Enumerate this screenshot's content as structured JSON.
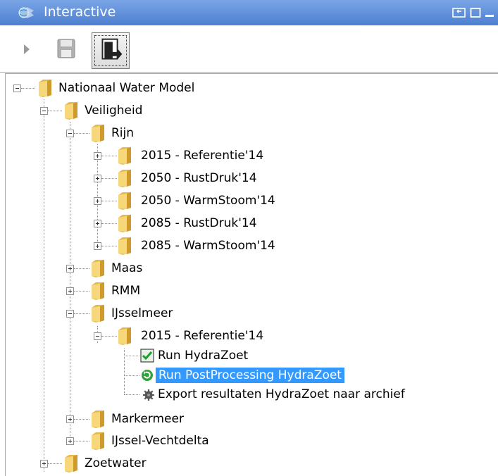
{
  "window": {
    "title": "Interactive",
    "title_color": "#ffffff",
    "titlebar_color": "#5d8ad8"
  },
  "toolbar": {
    "buttons": [
      {
        "name": "run-button",
        "icon": "play-triangle-icon",
        "enabled": false
      },
      {
        "name": "save-button",
        "icon": "floppy-disk-icon",
        "enabled": false
      },
      {
        "name": "export-button",
        "icon": "export-document-icon",
        "enabled": true
      }
    ]
  },
  "tree": {
    "root": {
      "label": "Nationaal Water Model",
      "expanded": true
    },
    "veiligheid": {
      "label": "Veiligheid",
      "expanded": true
    },
    "rijn": {
      "label": "Rijn",
      "expanded": true
    },
    "rijn_items": [
      {
        "label": "2015 - Referentie'14"
      },
      {
        "label": "2050 - RustDruk'14"
      },
      {
        "label": "2050 - WarmStoom'14"
      },
      {
        "label": "2085 - RustDruk'14"
      },
      {
        "label": "2085 - WarmStoom'14"
      }
    ],
    "maas": {
      "label": "Maas"
    },
    "rmm": {
      "label": "RMM"
    },
    "ijsselmeer": {
      "label": "IJsselmeer",
      "expanded": true
    },
    "ijsselmeer_2015": {
      "label": "2015 - Referentie'14",
      "expanded": true
    },
    "tasks": [
      {
        "label": "Run HydraZoet",
        "status": "completed",
        "icon": "green-checkmark-icon"
      },
      {
        "label": "Run PostProcessing HydraZoet",
        "status": "running",
        "icon": "refresh-icon",
        "selected": true
      },
      {
        "label": "Export resultaten HydraZoet naar archief",
        "status": "pending",
        "icon": "gear-icon"
      }
    ],
    "markermeer": {
      "label": "Markermeer"
    },
    "ijssel_vechtdelta": {
      "label": "IJssel-Vechtdelta"
    },
    "zoetwater": {
      "label": "Zoetwater"
    },
    "selection_color": "#3399ff"
  }
}
